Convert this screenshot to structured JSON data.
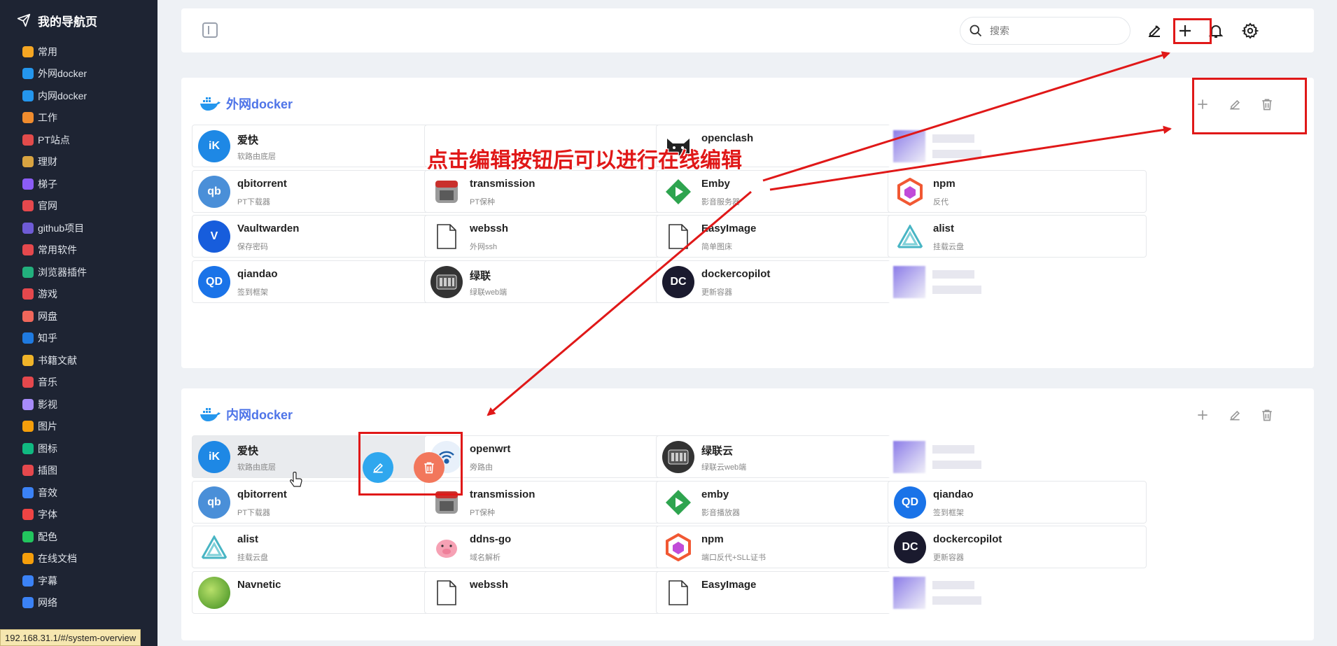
{
  "sidebar": {
    "title": "我的导航页",
    "items": [
      {
        "label": "常用",
        "icon": "star-icon",
        "color": "#f5a623"
      },
      {
        "label": "外网docker",
        "icon": "docker-icon",
        "color": "#2496ed"
      },
      {
        "label": "内网docker",
        "icon": "docker-icon",
        "color": "#2496ed"
      },
      {
        "label": "工作",
        "icon": "briefcase-icon",
        "color": "#f08c2e"
      },
      {
        "label": "PT站点",
        "icon": "p-letter-icon",
        "color": "#e24b4b"
      },
      {
        "label": "理财",
        "icon": "money-bag-icon",
        "color": "#d9a441"
      },
      {
        "label": "梯子",
        "icon": "ladder-icon",
        "color": "#8b5cf6"
      },
      {
        "label": "官网",
        "icon": "home-icon",
        "color": "#e5484d"
      },
      {
        "label": "github项目",
        "icon": "github-icon",
        "color": "#6e5bd6"
      },
      {
        "label": "常用软件",
        "icon": "apps-icon",
        "color": "#e5484d"
      },
      {
        "label": "浏览器插件",
        "icon": "puzzle-icon",
        "color": "#22b07d"
      },
      {
        "label": "游戏",
        "icon": "gamepad-icon",
        "color": "#e5484d"
      },
      {
        "label": "网盘",
        "icon": "cloud-drive-icon",
        "color": "#f0675b"
      },
      {
        "label": "知乎",
        "icon": "zhihu-icon",
        "color": "#1f7ae0"
      },
      {
        "label": "书籍文献",
        "icon": "books-icon",
        "color": "#f0b429"
      },
      {
        "label": "音乐",
        "icon": "music-icon",
        "color": "#e5484d"
      },
      {
        "label": "影视",
        "icon": "video-icon",
        "color": "#a78bfa"
      },
      {
        "label": "图片",
        "icon": "image-icon",
        "color": "#f59e0b"
      },
      {
        "label": "图标",
        "icon": "icon-set-icon",
        "color": "#10b981"
      },
      {
        "label": "插图",
        "icon": "illustration-icon",
        "color": "#e5484d"
      },
      {
        "label": "音效",
        "icon": "sound-wave-icon",
        "color": "#3b82f6"
      },
      {
        "label": "字体",
        "icon": "font-icon",
        "color": "#ef4444"
      },
      {
        "label": "配色",
        "icon": "palette-icon",
        "color": "#22c55e"
      },
      {
        "label": "在线文档",
        "icon": "document-icon",
        "color": "#f59e0b"
      },
      {
        "label": "字幕",
        "icon": "subtitle-icon",
        "color": "#3b82f6"
      },
      {
        "label": "网络",
        "icon": "globe-icon",
        "color": "#3b82f6"
      }
    ],
    "status_url": "192.168.31.1/#/system-overview"
  },
  "topbar": {
    "search_placeholder": "搜索"
  },
  "annotation": "点击编辑按钮后可以进行在线编辑",
  "sections": [
    {
      "title": "外网docker",
      "cards": [
        {
          "name": "爱快",
          "desc": "软路由底层",
          "logo": "iK",
          "color": "#1e88e5"
        },
        {
          "name": "",
          "desc": "",
          "logo": "",
          "color": "#ffffff"
        },
        {
          "name": "openclash",
          "desc": "",
          "logo": "cat",
          "color": "#222222"
        },
        {
          "name": "",
          "desc": "",
          "logo": "blur",
          "color": ""
        },
        {
          "name": "qbitorrent",
          "desc": "PT下载器",
          "logo": "qb",
          "color": "#4a8fd8"
        },
        {
          "name": "transmission",
          "desc": "PT保种",
          "logo": "tr",
          "color": "#888888"
        },
        {
          "name": "Emby",
          "desc": "影音服务器",
          "logo": "▶",
          "color": "#2ea44f"
        },
        {
          "name": "npm",
          "desc": "反代",
          "logo": "np",
          "color": "#f15833"
        },
        {
          "name": "Vaultwarden",
          "desc": "保存密码",
          "logo": "V",
          "color": "#175ddc"
        },
        {
          "name": "webssh",
          "desc": "外网ssh",
          "logo": "file",
          "color": "#ffffff"
        },
        {
          "name": "EasyImage",
          "desc": "简单图床",
          "logo": "file",
          "color": "#ffffff"
        },
        {
          "name": "alist",
          "desc": "挂载云盘",
          "logo": "alist",
          "color": "#ffffff"
        },
        {
          "name": "qiandao",
          "desc": "签到框架",
          "logo": "QD",
          "color": "#1a73e8"
        },
        {
          "name": "绿联",
          "desc": "绿联web端",
          "logo": "ug",
          "color": "#333333"
        },
        {
          "name": "dockercopilot",
          "desc": "更新容器",
          "logo": "DC",
          "color": "#1a1a2e"
        },
        {
          "name": "",
          "desc": "",
          "logo": "blur",
          "color": ""
        }
      ]
    },
    {
      "title": "内网docker",
      "cards": [
        {
          "name": "爱快",
          "desc": "软路由底层",
          "logo": "iK",
          "color": "#1e88e5"
        },
        {
          "name": "openwrt",
          "desc": "旁路由",
          "logo": "wifi",
          "color": "#e8f0fa"
        },
        {
          "name": "绿联云",
          "desc": "绿联云web端",
          "logo": "ug",
          "color": "#333333"
        },
        {
          "name": "",
          "desc": "",
          "logo": "blur",
          "color": ""
        },
        {
          "name": "qbitorrent",
          "desc": "PT下载器",
          "logo": "qb",
          "color": "#4a8fd8"
        },
        {
          "name": "transmission",
          "desc": "PT保种",
          "logo": "tr",
          "color": "#888888"
        },
        {
          "name": "emby",
          "desc": "影音播放器",
          "logo": "▶",
          "color": "#2ea44f"
        },
        {
          "name": "qiandao",
          "desc": "签到框架",
          "logo": "QD",
          "color": "#1a73e8"
        },
        {
          "name": "alist",
          "desc": "挂载云盘",
          "logo": "alist",
          "color": "#ffffff"
        },
        {
          "name": "ddns-go",
          "desc": "域名解析",
          "logo": "pig",
          "color": "#f5a3b5"
        },
        {
          "name": "npm",
          "desc": "端口反代+SLL证书",
          "logo": "np",
          "color": "#f15833"
        },
        {
          "name": "dockercopilot",
          "desc": "更新容器",
          "logo": "DC",
          "color": "#1a1a2e"
        },
        {
          "name": "Navnetic",
          "desc": "",
          "logo": "nv",
          "color": "#6ab023"
        },
        {
          "name": "webssh",
          "desc": "",
          "logo": "file",
          "color": "#ffffff"
        },
        {
          "name": "EasyImage",
          "desc": "",
          "logo": "file",
          "color": "#ffffff"
        },
        {
          "name": "",
          "desc": "",
          "logo": "blur",
          "color": ""
        }
      ]
    }
  ],
  "colors": {
    "accent": "#4e74e8",
    "annotation_red": "#e01818",
    "edit_blue": "#2fa7ee",
    "delete_orange": "#f2775c"
  }
}
